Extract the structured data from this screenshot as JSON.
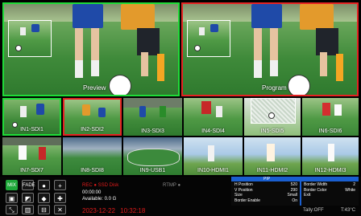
{
  "main": {
    "preview_label": "Preview",
    "program_label": "Program"
  },
  "inputs": [
    {
      "label": "IN1-SDI1"
    },
    {
      "label": "IN2-SDI2"
    },
    {
      "label": "IN3-SDI3"
    },
    {
      "label": "IN4-SDI4"
    },
    {
      "label": "IN5-SDI5"
    },
    {
      "label": "IN6-SDI6"
    },
    {
      "label": "IN7-SDI7"
    },
    {
      "label": "IN8-SDI8"
    },
    {
      "label": "IN9-USB1"
    },
    {
      "label": "IN10-HDMI1"
    },
    {
      "label": "IN11-HDMI2"
    },
    {
      "label": "IN12-HDMI3"
    }
  ],
  "controls": {
    "mix_label": "MIX",
    "fade_label": "FADE"
  },
  "status": {
    "rec_label": "REC",
    "rec_target": "SSD Disk",
    "rec_time": "00:00:00",
    "available": "Available: 0.0 G",
    "rtmp_label": "RTMP",
    "date": "2023-12-22",
    "time": "10:32:18",
    "tally": "Tally:OFF",
    "temp": "T:43°C"
  },
  "pip": {
    "title": "PIP",
    "rows": [
      {
        "label": "H Position",
        "value": "520"
      },
      {
        "label": "V Position",
        "value": "290"
      },
      {
        "label": "Size",
        "value": "Small"
      },
      {
        "label": "Border Enable",
        "value": "On"
      }
    ],
    "border_width_label": "Border Width",
    "border_width_value": "2",
    "border_color_label": "Border Color",
    "border_color_value": "White",
    "exit_label": "Exit"
  },
  "colors": {
    "preview_border": "#1fdc38",
    "program_border": "#e52222",
    "pip_accent": "#1a5fd0",
    "rec_red": "#e11b1b"
  }
}
